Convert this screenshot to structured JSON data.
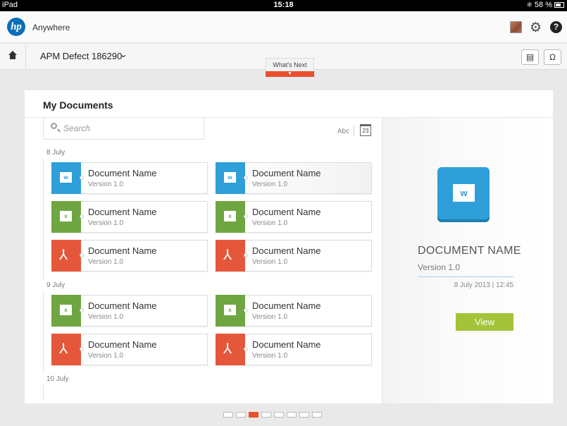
{
  "status_bar": {
    "device": "iPad",
    "time": "15:18",
    "battery": "58 %"
  },
  "app": {
    "logo_text": "hp",
    "name": "Anywhere"
  },
  "header": {
    "settings_icon": "gear-icon",
    "help_label": "?"
  },
  "context": {
    "title": "APM Defect 186290",
    "whats_next": "What's Next"
  },
  "panel": {
    "title": "My Documents",
    "search_placeholder": "Search",
    "sort_abc_label": "Abc",
    "sort_date_label": "23"
  },
  "groups": [
    {
      "label": "8 July",
      "docs": [
        {
          "name": "Document Name",
          "version": "Version 1.0",
          "type": "word",
          "glyph": "w"
        },
        {
          "name": "Document Name",
          "version": "Version 1.0",
          "type": "word",
          "glyph": "w",
          "selected": true
        },
        {
          "name": "Document Name",
          "version": "Version 1.0",
          "type": "excel",
          "glyph": "x"
        },
        {
          "name": "Document Name",
          "version": "Version 1.0",
          "type": "excel",
          "glyph": "x"
        },
        {
          "name": "Document Name",
          "version": "Version 1.0",
          "type": "pdf",
          "glyph": "⅄"
        },
        {
          "name": "Document Name",
          "version": "Version 1.0",
          "type": "pdf",
          "glyph": "⅄"
        }
      ]
    },
    {
      "label": "9 July",
      "docs": [
        {
          "name": "Document Name",
          "version": "Version 1.0",
          "type": "excel",
          "glyph": "x"
        },
        {
          "name": "Document Name",
          "version": "Version 1.0",
          "type": "excel",
          "glyph": "x"
        },
        {
          "name": "Document Name",
          "version": "Version 1.0",
          "type": "pdf",
          "glyph": "⅄"
        },
        {
          "name": "Document Name",
          "version": "Version 1.0",
          "type": "pdf",
          "glyph": "⅄"
        }
      ]
    },
    {
      "label": "10 July",
      "docs": []
    }
  ],
  "detail": {
    "name": "DOCUMENT NAME",
    "version": "Version 1.0",
    "date": "8 July 2013 | 12:45",
    "view_label": "View",
    "icon_glyph": "w"
  },
  "pager": {
    "count": 8,
    "active_index": 2
  },
  "colors": {
    "word": "#2e9fd8",
    "excel": "#6fa641",
    "pdf": "#e5573a",
    "accent": "#e8502e",
    "view_button": "#a4c23a"
  }
}
